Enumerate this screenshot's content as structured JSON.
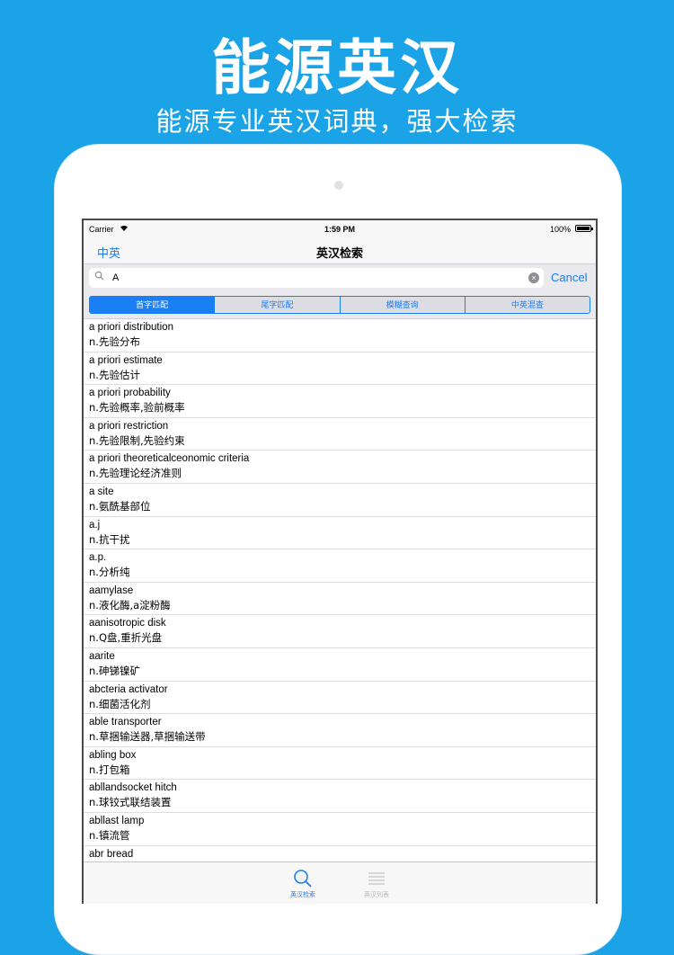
{
  "promo": {
    "title": "能源英汉",
    "subtitle": "能源专业英汉词典，强大检索"
  },
  "statusbar": {
    "carrier": "Carrier",
    "time": "1:59 PM",
    "battery": "100%"
  },
  "navbar": {
    "back_label": "中英",
    "title": "英汉检索"
  },
  "search": {
    "value": "A",
    "placeholder": "",
    "cancel_label": "Cancel"
  },
  "segments": [
    {
      "label": "首字匹配",
      "active": true
    },
    {
      "label": "尾字匹配",
      "active": false
    },
    {
      "label": "模糊查询",
      "active": false
    },
    {
      "label": "中英混查",
      "active": false
    }
  ],
  "entries": [
    {
      "term": "a priori distribution",
      "def": "n.先验分布"
    },
    {
      "term": "a priori estimate",
      "def": "n.先验估计"
    },
    {
      "term": "a priori probability",
      "def": "n.先验概率,验前概率"
    },
    {
      "term": "a priori restriction",
      "def": "n.先验限制,先验约束"
    },
    {
      "term": "a priori theoreticalceonomic criteria",
      "def": "n.先验理论经济准则"
    },
    {
      "term": "a site",
      "def": "n.氨酰基部位"
    },
    {
      "term": "a.j",
      "def": "n.抗干扰"
    },
    {
      "term": "a.p.",
      "def": "n.分析纯"
    },
    {
      "term": "aamylase",
      "def": "n.液化酶,a淀粉酶"
    },
    {
      "term": "aanisotropic disk",
      "def": "n.Q盘,重折光盘"
    },
    {
      "term": "aarite",
      "def": "n.砷锑镍矿"
    },
    {
      "term": "abcteria activator",
      "def": "n.细菌活化剂"
    },
    {
      "term": "able transporter",
      "def": "n.草捆输送器,草捆输送带"
    },
    {
      "term": "abling box",
      "def": "n.打包箱"
    },
    {
      "term": "abllandsocket hitch",
      "def": "n.球铰式联结装置"
    },
    {
      "term": "abllast lamp",
      "def": "n.镇流管"
    },
    {
      "term": "abr bread",
      "def": ""
    }
  ],
  "tabbar": {
    "search_label": "英汉检索",
    "list_label": "英汉列表"
  },
  "colors": {
    "background": "#1ba3e8",
    "accent": "#1a7ef5"
  }
}
